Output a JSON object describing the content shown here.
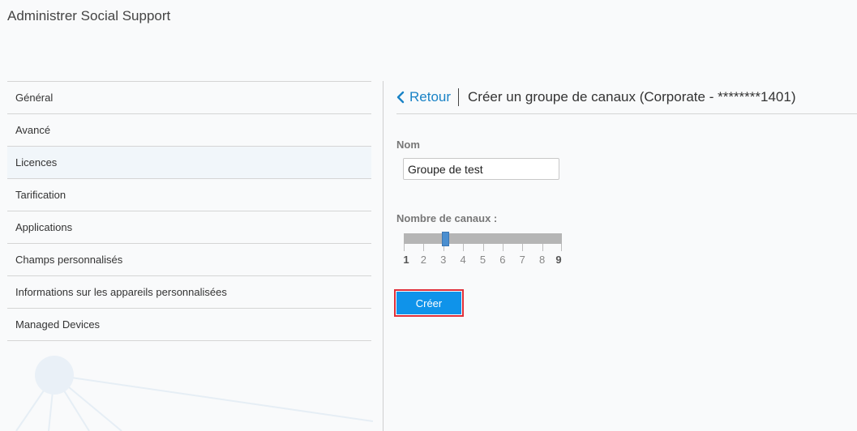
{
  "app": {
    "title": "Administrer Social Support"
  },
  "sidebar": {
    "items": [
      {
        "label": "Général"
      },
      {
        "label": "Avancé"
      },
      {
        "label": "Licences"
      },
      {
        "label": "Tarification"
      },
      {
        "label": "Applications"
      },
      {
        "label": "Champs personnalisés"
      },
      {
        "label": "Informations sur les appareils personnalisées"
      },
      {
        "label": "Managed Devices"
      }
    ],
    "active_index": 2
  },
  "header": {
    "back_label": "Retour",
    "title": "Créer un groupe de canaux (Corporate - ********1401)"
  },
  "form": {
    "name_label": "Nom",
    "name_value": "Groupe de test",
    "channels_label": "Nombre de canaux :",
    "slider": {
      "min": 1,
      "max": 9,
      "value": 3,
      "ticks": [
        "1",
        "2",
        "3",
        "4",
        "5",
        "6",
        "7",
        "8",
        "9"
      ]
    },
    "create_label": "Créer"
  },
  "colors": {
    "accent": "#1a83c6",
    "button": "#0f93ea",
    "highlight_border": "#e0303a",
    "slider_handle": "#4a8fd0"
  },
  "icons": {
    "back": "chevron-left-icon"
  }
}
